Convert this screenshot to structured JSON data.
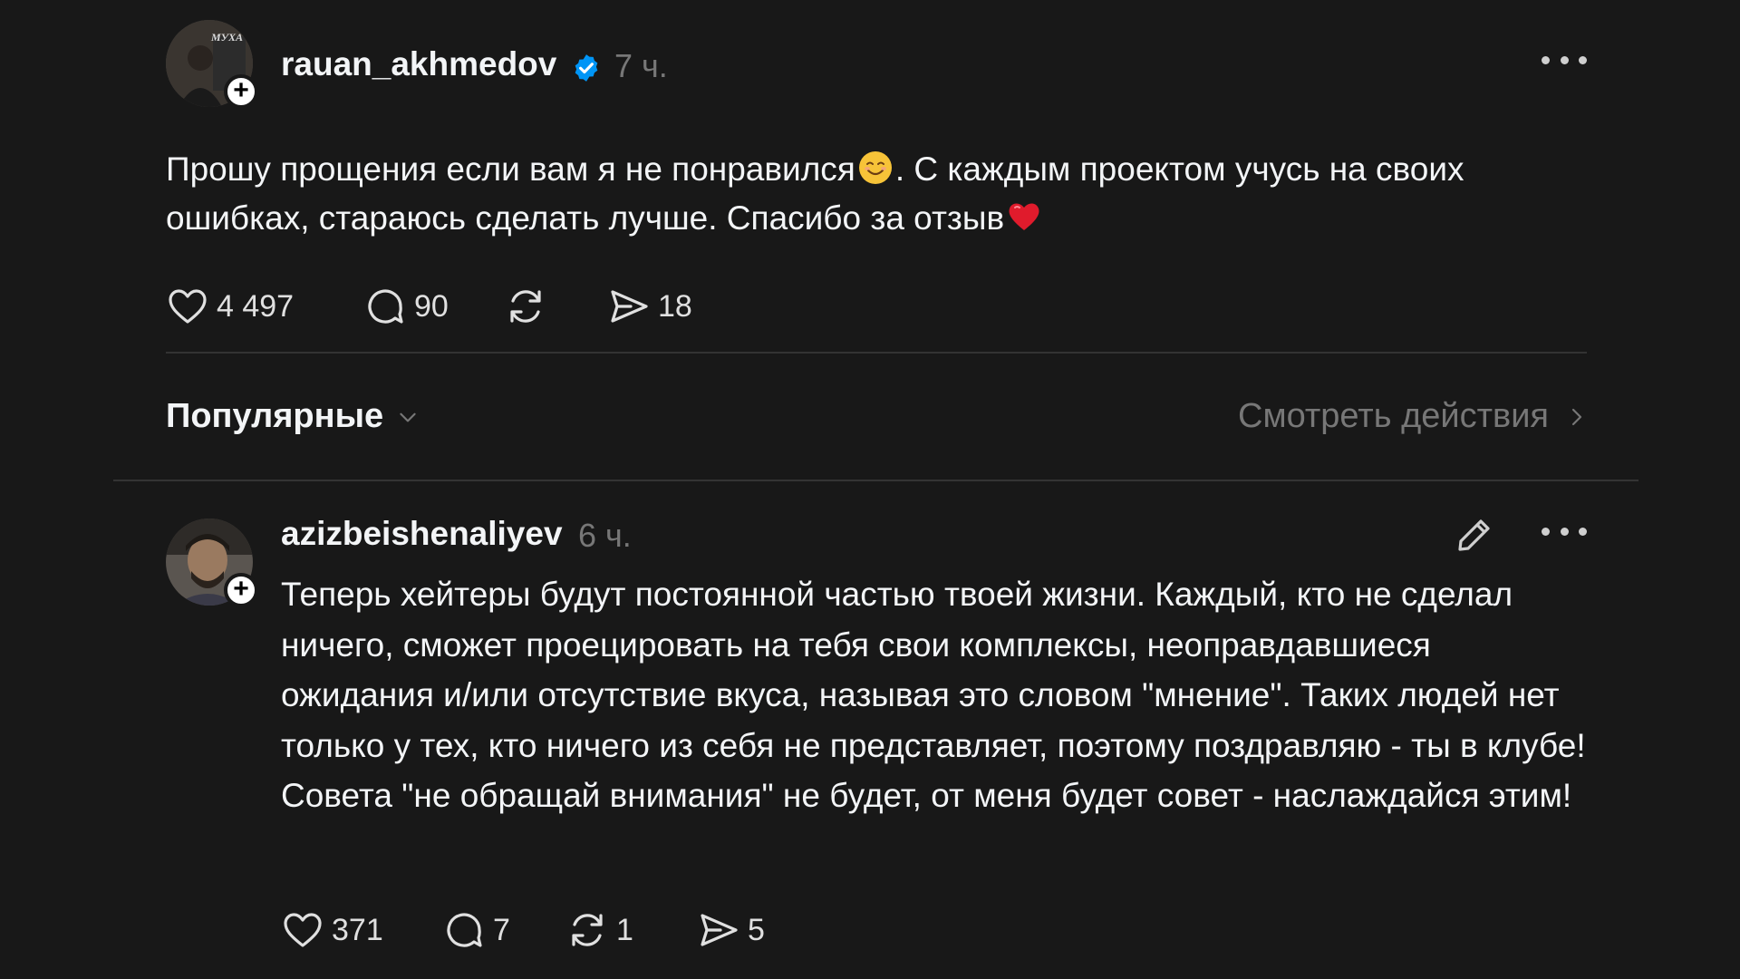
{
  "main_post": {
    "username": "rauan_akhmedov",
    "time": "7 ч.",
    "text_part1": "Прошу прощения если вам я не понравился",
    "text_part2": ". С каждым проектом учусь на своих ошибках, стараюсь сделать лучше. Спасибо за отзыв",
    "likes": "4 497",
    "comments": "90",
    "shares": "18",
    "avatar_text": "МУХА"
  },
  "sort": {
    "label": "Популярные",
    "view_actions": "Смотреть действия"
  },
  "reply": {
    "username": "azizbeishenaliyev",
    "time": "6 ч.",
    "text": "Теперь хейтеры будут постоянной частью твоей жизни. Каждый, кто не сделал ничего, сможет проецировать на тебя свои комплексы, неоправдавшиеся ожидания и/или отсутствие вкуса, называя это словом \"мнение\". Таких людей нет только у тех, кто ничего из себя не представляет, поэтому поздравляю - ты в клубе! Совета \"не обращай внимания\" не будет, от меня будет совет - наслаждайся этим!",
    "likes": "371",
    "comments": "7",
    "reposts": "1",
    "shares": "5"
  },
  "colors": {
    "background": "#181818",
    "text": "#f3f5f7",
    "muted": "#777777",
    "verified": "#0095f6",
    "divider": "#333333"
  },
  "icons": [
    "heart-icon",
    "comment-icon",
    "repost-icon",
    "share-icon",
    "verified-icon",
    "more-icon",
    "edit-icon",
    "chevron-down-icon",
    "chevron-right-icon",
    "follow-plus-icon"
  ]
}
